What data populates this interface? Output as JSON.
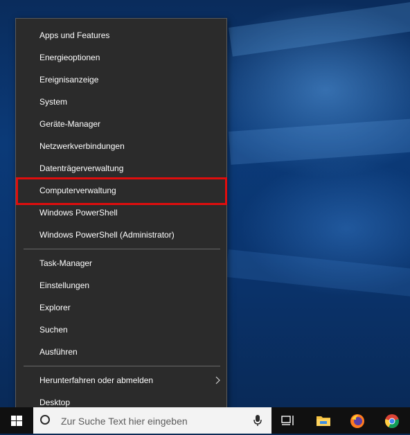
{
  "menu": {
    "group1": [
      {
        "label": "Apps und Features",
        "name": "menu-item-apps-und-features"
      },
      {
        "label": "Energieoptionen",
        "name": "menu-item-energieoptionen"
      },
      {
        "label": "Ereignisanzeige",
        "name": "menu-item-ereignisanzeige"
      },
      {
        "label": "System",
        "name": "menu-item-system"
      },
      {
        "label": "Geräte-Manager",
        "name": "menu-item-geraete-manager"
      },
      {
        "label": "Netzwerkverbindungen",
        "name": "menu-item-netzwerkverbindungen"
      },
      {
        "label": "Datenträgerverwaltung",
        "name": "menu-item-datentraegerverwaltung"
      },
      {
        "label": "Computerverwaltung",
        "name": "menu-item-computerverwaltung"
      },
      {
        "label": "Windows PowerShell",
        "name": "menu-item-windows-powershell"
      },
      {
        "label": "Windows PowerShell (Administrator)",
        "name": "menu-item-windows-powershell-admin"
      }
    ],
    "group2": [
      {
        "label": "Task-Manager",
        "name": "menu-item-task-manager"
      },
      {
        "label": "Einstellungen",
        "name": "menu-item-einstellungen"
      },
      {
        "label": "Explorer",
        "name": "menu-item-explorer"
      },
      {
        "label": "Suchen",
        "name": "menu-item-suchen"
      },
      {
        "label": "Ausführen",
        "name": "menu-item-ausfuehren"
      }
    ],
    "group3": [
      {
        "label": "Herunterfahren oder abmelden",
        "name": "menu-item-herunterfahren",
        "submenu": true
      },
      {
        "label": "Desktop",
        "name": "menu-item-desktop"
      }
    ],
    "highlighted": "Computerverwaltung"
  },
  "taskbar": {
    "search_placeholder": "Zur Suche Text hier eingeben",
    "icons": [
      "start-icon",
      "search-icon",
      "microphone-icon",
      "task-view-icon",
      "file-explorer-icon",
      "firefox-icon",
      "chrome-icon"
    ]
  },
  "colors": {
    "menu_bg": "#2b2b2b",
    "highlight_border": "#e00d0d",
    "taskbar_bg": "#101010",
    "wallpaper": "#0b3a78"
  }
}
